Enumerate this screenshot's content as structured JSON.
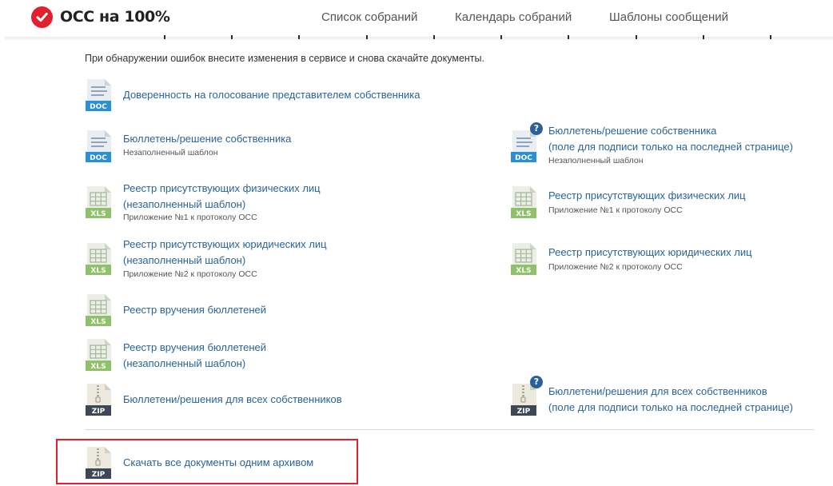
{
  "header": {
    "logo_text": "ОСС на 100%",
    "brand_color": "#e0202c",
    "nav": [
      "Список собраний",
      "Календарь собраний",
      "Шаблоны сообщений"
    ]
  },
  "note": "При обнаружении ошибок внесите изменения в сервисе и снова скачайте документы.",
  "documents": {
    "proxy": {
      "title": "Доверенность на голосование представителем собственника",
      "type": "DOC"
    },
    "ballot": {
      "title": "Бюллетень/решение собственника",
      "subtitle": "Незаполненный шаблон",
      "type": "DOC"
    },
    "ballot_last_page": {
      "title_line1": "Бюллетень/решение собственника",
      "title_line2": "(поле для подписи только на последней странице)",
      "subtitle": "Незаполненный шаблон",
      "type": "DOC"
    },
    "registry_individuals_blank": {
      "title_line1": "Реестр присутствующих физических лиц",
      "title_line2": "(незаполненный шаблон)",
      "subtitle": "Приложение №1 к протоколу ОСС",
      "type": "XLS"
    },
    "registry_individuals": {
      "title": "Реестр присутствующих физических лиц",
      "subtitle": "Приложение №1 к протоколу ОСС",
      "type": "XLS"
    },
    "registry_legal_blank": {
      "title_line1": "Реестр присутствующих юридических лиц",
      "title_line2": "(незаполненный шаблон)",
      "subtitle": "Приложение №2 к протоколу ОСС",
      "type": "XLS"
    },
    "registry_legal": {
      "title": "Реестр присутствующих юридических лиц",
      "subtitle": "Приложение №2 к протоколу ОСС",
      "type": "XLS"
    },
    "delivery_registry": {
      "title": "Реестр вручения бюллетеней",
      "type": "XLS"
    },
    "delivery_registry_blank": {
      "title_line1": "Реестр вручения бюллетеней",
      "title_line2": "(незаполненный шаблон)",
      "type": "XLS"
    },
    "all_ballots": {
      "title": "Бюллетени/решения для всех собственников",
      "type": "ZIP"
    },
    "all_ballots_last_page": {
      "title_line1": "Бюллетени/решения для всех собственников",
      "title_line2": "(поле для подписи только на последней странице)",
      "type": "ZIP"
    }
  },
  "archive": {
    "title": "Скачать все документы одним архивом",
    "type": "ZIP"
  },
  "help_glyph": "?",
  "colors": {
    "link": "#2a6496",
    "doc": "#2b8fd6",
    "xls": "#8fc06a",
    "zip": "#3d4758",
    "help": "#2c5f98",
    "highlight": "#e0202c"
  }
}
